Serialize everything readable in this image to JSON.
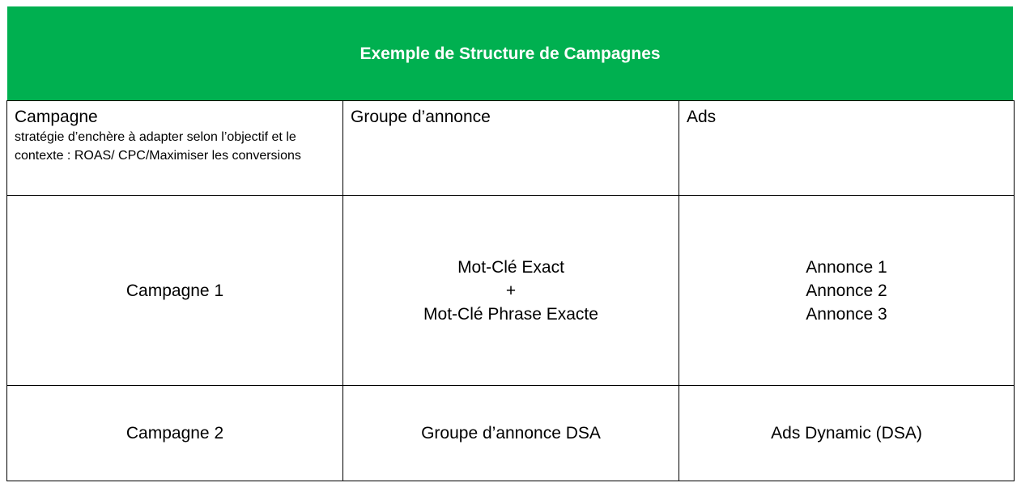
{
  "title": "Exemple de Structure de Campagnes",
  "header": {
    "campagne": {
      "label": "Campagne",
      "subtext": "stratégie d’enchère à adapter selon l’objectif et le contexte : ROAS/ CPC/Maximiser les conversions"
    },
    "groupe": {
      "label": "Groupe d’annonce"
    },
    "ads": {
      "label": "Ads"
    }
  },
  "rows": [
    {
      "campagne": "Campagne 1",
      "groupe": [
        "Mot-Clé Exact",
        "+",
        "Mot-Clé Phrase Exacte"
      ],
      "ads": [
        "Annonce 1",
        "Annonce 2",
        "Annonce 3"
      ]
    },
    {
      "campagne": "Campagne 2",
      "groupe": [
        "Groupe d’annonce DSA"
      ],
      "ads": [
        "Ads Dynamic (DSA)"
      ]
    }
  ],
  "colors": {
    "title_bar": "#00b050",
    "title_text": "#ffffff",
    "border": "#000000"
  }
}
